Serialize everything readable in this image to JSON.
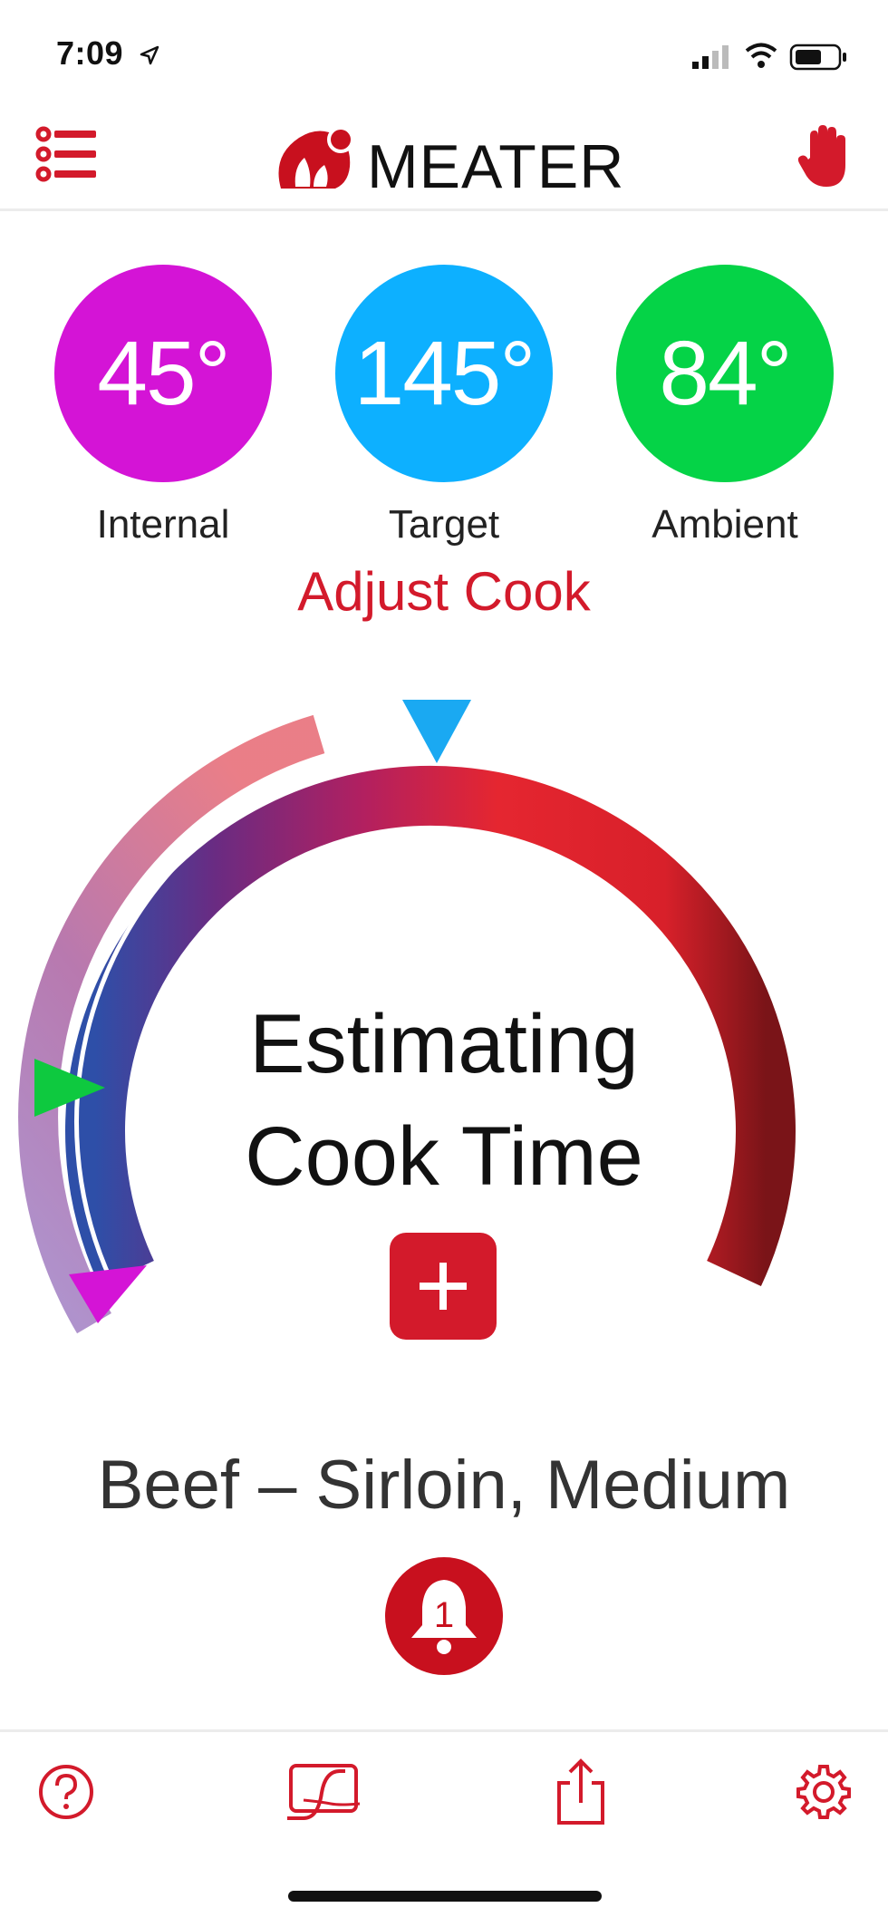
{
  "status": {
    "time": "7:09"
  },
  "header": {
    "title": "MEATER"
  },
  "temps": [
    {
      "value": "45°",
      "label": "Internal",
      "color": "#d414d6"
    },
    {
      "value": "145°",
      "label": "Target",
      "color": "#0db0ff"
    },
    {
      "value": "84°",
      "label": "Ambient",
      "color": "#05d347"
    }
  ],
  "adjust_label": "Adjust Cook",
  "gauge": {
    "line1": "Estimating",
    "line2": "Cook Time"
  },
  "cook_name": "Beef – Sirloin, Medium",
  "alert_count": "1",
  "colors": {
    "accent": "#d31a2b"
  },
  "icons": {
    "menu": "menu-list-icon",
    "stop": "hand-stop-icon",
    "help": "help-icon",
    "graph": "graph-icon",
    "share": "share-icon",
    "settings": "gear-icon"
  }
}
